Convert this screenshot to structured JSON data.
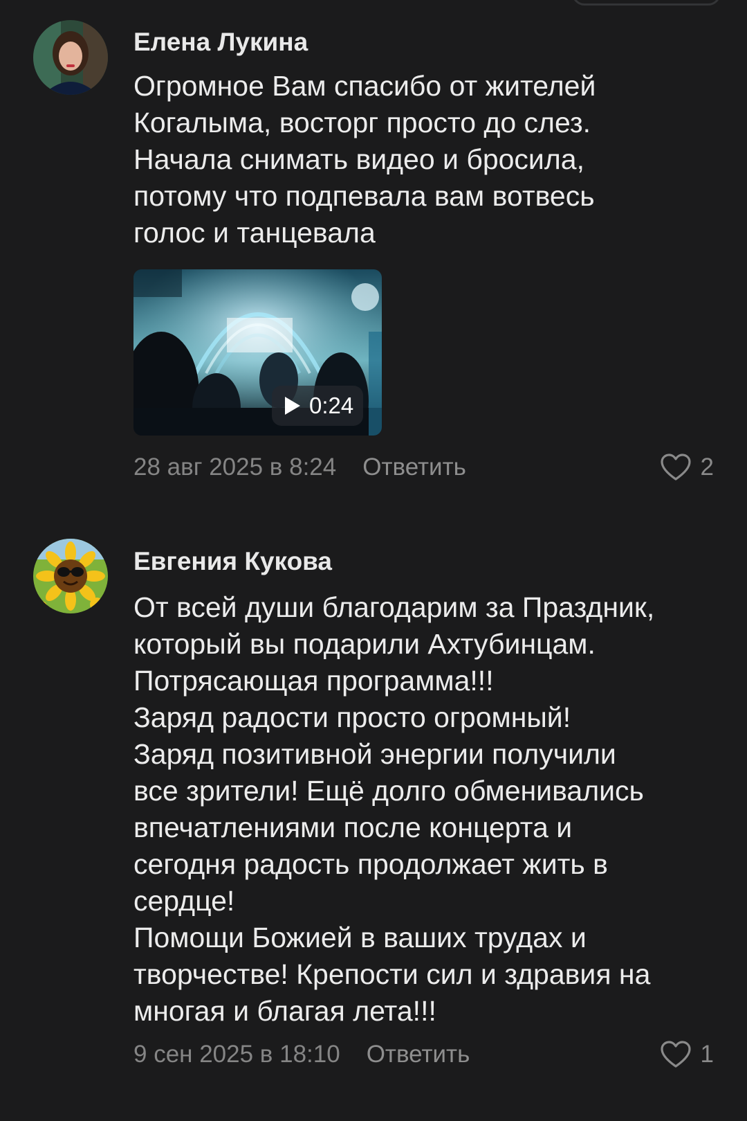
{
  "comments": [
    {
      "author": "Елена Лукина",
      "text": "Огромное Вам спасибо от жителей\nКогалыма, восторг просто до слез.\nНачала снимать видео и бросила,\nпотому что подпевала вам вотвесь\nголос и танцевала",
      "video": {
        "duration": "0:24"
      },
      "date": "28 авг 2025 в 8:24",
      "reply_label": "Ответить",
      "likes": "2"
    },
    {
      "author": "Евгения Кукова",
      "text": "От всей души благодарим за Праздник,\nкоторый вы подарили Ахтубинцам.\nПотрясающая программа!!!\nЗаряд радости просто огромный!\nЗаряд позитивной энергии получили\nвсе зрители! Ещё долго обменивались\nвпечатлениями после концерта и\nсегодня радость продолжает жить в\nсердце!\nПомощи Божией в ваших трудах и\nтворчестве! Крепости сил и здравия на\nмногая и благая лета!!!",
      "date": "9 сен 2025 в 18:10",
      "reply_label": "Ответить",
      "likes": "1"
    }
  ],
  "colors": {
    "background": "#1b1b1c",
    "text": "#ececec",
    "meta": "#858585"
  }
}
